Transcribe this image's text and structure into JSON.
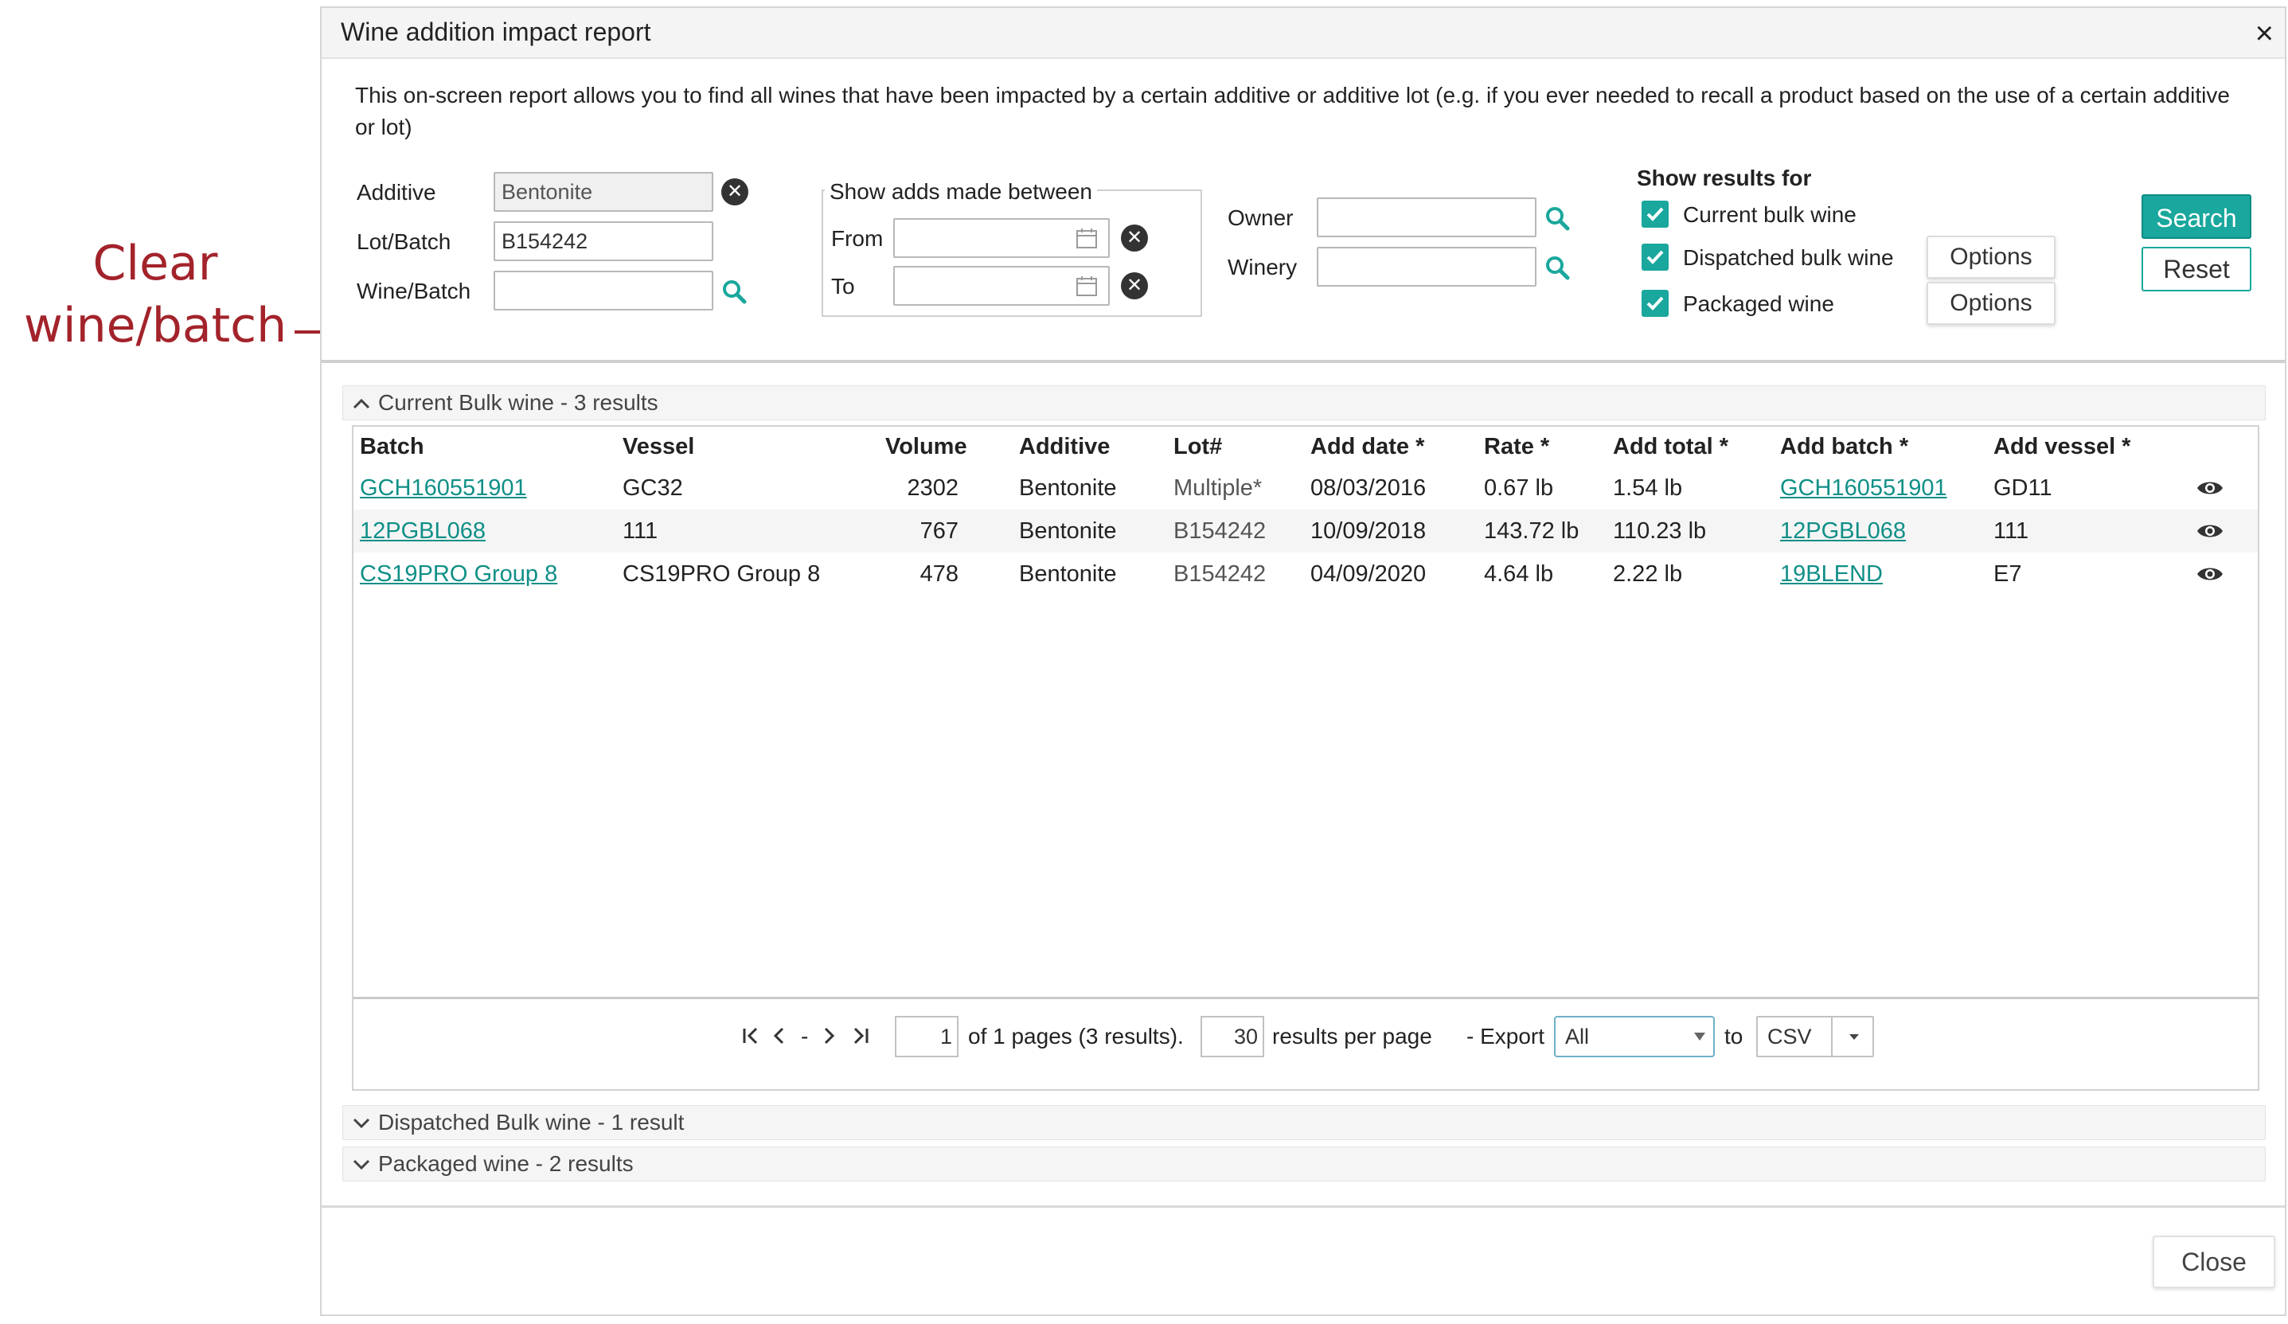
{
  "annotation": {
    "text_line1": "Clear",
    "text_line2": "wine/batch"
  },
  "dialog": {
    "title": "Wine addition impact report",
    "close_symbol": "×",
    "description": "This on-screen report allows you to find all wines that have been impacted by a certain additive or additive lot (e.g. if you ever needed to recall a product based on the use of a certain additive or lot)"
  },
  "filters": {
    "additive_label": "Additive",
    "additive_value": "Bentonite",
    "lot_label": "Lot/Batch",
    "lot_value": "B154242",
    "wine_label": "Wine/Batch",
    "wine_value": "",
    "date_group_label": "Show adds made between",
    "from_label": "From",
    "to_label": "To",
    "from_value": "",
    "to_value": "",
    "owner_label": "Owner",
    "owner_value": "",
    "winery_label": "Winery",
    "winery_value": ""
  },
  "show_results": {
    "heading": "Show results for",
    "current_bulk": "Current bulk wine",
    "dispatched_bulk": "Dispatched bulk wine",
    "packaged": "Packaged wine",
    "options_label": "Options"
  },
  "buttons": {
    "search": "Search",
    "reset": "Reset",
    "close": "Close"
  },
  "sections": {
    "current": "Current Bulk wine - 3 results",
    "dispatched": "Dispatched Bulk wine - 1 result",
    "packaged": "Packaged wine - 2 results"
  },
  "table": {
    "headers": [
      "Batch",
      "Vessel",
      "Volume",
      "Additive",
      "Lot#",
      "Add date *",
      "Rate *",
      "Add total *",
      "Add batch *",
      "Add vessel *"
    ],
    "rows": [
      {
        "batch": "GCH160551901",
        "vessel": "GC32",
        "volume": "2302",
        "additive": "Bentonite",
        "lot": "Multiple*",
        "add_date": "08/03/2016",
        "rate": "0.67 lb",
        "add_total": "1.54 lb",
        "add_batch": "GCH160551901",
        "add_vessel": "GD11"
      },
      {
        "batch": "12PGBL068",
        "vessel": "111",
        "volume": "767",
        "additive": "Bentonite",
        "lot": "B154242",
        "add_date": "10/09/2018",
        "rate": "143.72 lb",
        "add_total": "110.23 lb",
        "add_batch": "12PGBL068",
        "add_vessel": "111"
      },
      {
        "batch": "CS19PRO Group 8",
        "vessel": "CS19PRO Group 8",
        "volume": "478",
        "additive": "Bentonite",
        "lot": "B154242",
        "add_date": "04/09/2020",
        "rate": "4.64 lb",
        "add_total": "2.22 lb",
        "add_batch": "19BLEND",
        "add_vessel": "E7"
      }
    ]
  },
  "pager": {
    "first": "|<",
    "prev": "<",
    "dash": "-",
    "next": ">",
    "last": ">|",
    "page": "1",
    "pages_text": "of 1 pages (3 results).",
    "per_page": "30",
    "per_page_text": "results per page",
    "export_text": "- Export",
    "export_scope": "All",
    "to_text": "to",
    "format": "CSV"
  },
  "colors": {
    "accent": "#1aa79d",
    "link": "#0f8f87",
    "annotation": "#a3232b"
  }
}
